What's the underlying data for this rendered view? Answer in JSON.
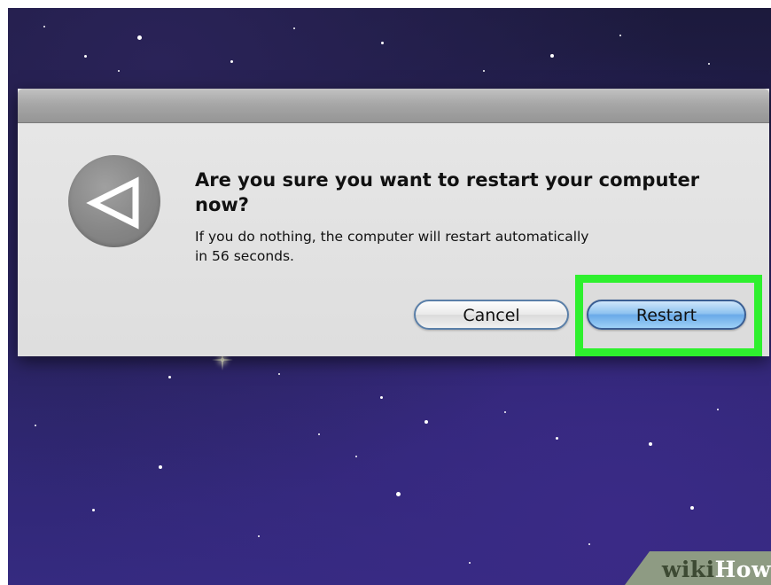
{
  "dialog": {
    "headline": "Are you sure you want to restart your computer now?",
    "message_line1": "If you do nothing, the computer will restart automatically",
    "message_line2": "in 56 seconds.",
    "icon": "power-restart-icon",
    "buttons": {
      "cancel_label": "Cancel",
      "restart_label": "Restart"
    }
  },
  "highlight": {
    "target": "restart-button",
    "color": "#2ef02e"
  },
  "watermark": {
    "part1": "wiki",
    "part2": "How"
  },
  "colors": {
    "desktop_background": "#2e2670",
    "dialog_background": "#e6e6e6",
    "default_button": "#6aaae8"
  }
}
